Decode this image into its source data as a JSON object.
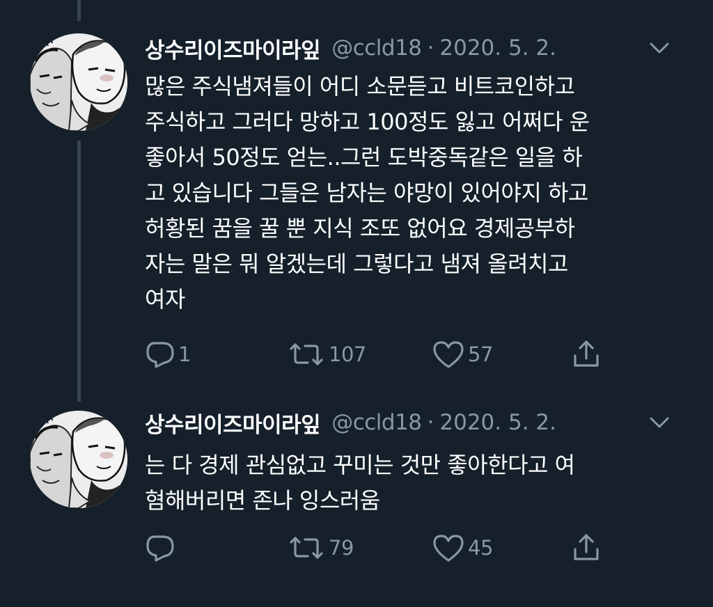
{
  "colors": {
    "background": "#15202b",
    "text_primary": "#ffffff",
    "text_secondary": "#8899a6",
    "thread_line": "#38444d"
  },
  "tweets": [
    {
      "author": {
        "display_name": "상수리이즈마이라잎",
        "handle": "@ccld18",
        "avatar_icon": "avatar-manga-drawing"
      },
      "separator": "·",
      "date": "2020. 5. 2.",
      "body": "많은 주식냄져들이 어디 소문듣고 비트코인하고\n주식하고 그러다 망하고 100정도 잃고 어쩌다 운\n좋아서 50정도 얻는..그런 도박중독같은 일을 하\n고 있습니다 그들은 남자는 야망이 있어야지 하고\n허황된 꿈을 꿀 뿐 지식 조또 없어요 경제공부하\n자는 말은 뭐 알겠는데 그렇다고 냄져 올려치고\n여자",
      "stats": {
        "replies": "1",
        "retweets": "107",
        "likes": "57"
      }
    },
    {
      "author": {
        "display_name": "상수리이즈마이라잎",
        "handle": "@ccld18",
        "avatar_icon": "avatar-manga-drawing"
      },
      "separator": "·",
      "date": "2020. 5. 2.",
      "body": "는 다 경제 관심없고 꾸미는 것만 좋아한다고 여\n혐해버리면 존나 잉스러움",
      "stats": {
        "replies": "",
        "retweets": "79",
        "likes": "45"
      }
    }
  ]
}
